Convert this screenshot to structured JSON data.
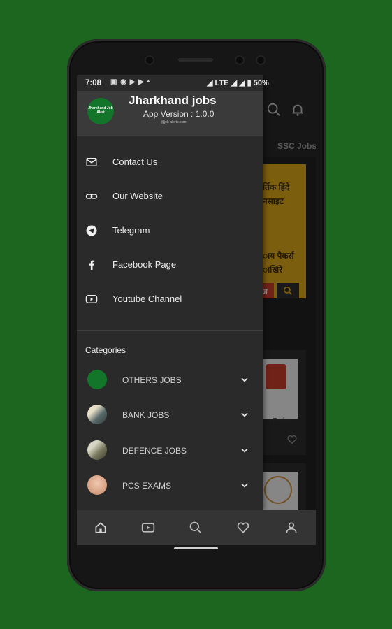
{
  "status_bar": {
    "time": "7:08",
    "network": "LTE",
    "battery": "50%"
  },
  "drawer": {
    "logo_text": "Jharkhand Job Alert",
    "title": "Jharkhand jobs",
    "version": "App Version : 1.0.0",
    "website": "@job-alerts.com",
    "menu": [
      {
        "label": "Contact Us",
        "icon": "mail-icon"
      },
      {
        "label": "Our Website",
        "icon": "link-icon"
      },
      {
        "label": "Telegram",
        "icon": "telegram-icon"
      },
      {
        "label": "Facebook Page",
        "icon": "facebook-icon"
      },
      {
        "label": "Youtube Channel",
        "icon": "youtube-icon"
      }
    ],
    "categories_heading": "Categories",
    "categories": [
      {
        "label": "OTHERS JOBS",
        "thumb_color": "#13752a"
      },
      {
        "label": "BANK JOBS",
        "thumb_color": "#6e6a5c"
      },
      {
        "label": "DEFENCE JOBS",
        "thumb_color": "#8a8a78"
      },
      {
        "label": "PCS EXAMS",
        "thumb_color": "#d9a58a"
      }
    ]
  },
  "background": {
    "tab": "SSC Jobs",
    "banner_lines": [
      "र्तिक हिंदे",
      "नसाइट",
      "ाय पैकर्स",
      "ाखिरे",
      "ज"
    ],
    "card_caption": "a Police"
  },
  "bottom_nav": [
    "home-icon",
    "video-icon",
    "search-icon",
    "heart-icon",
    "profile-icon"
  ],
  "colors": {
    "background_green": "#1c6620",
    "drawer": "#2a2a2a",
    "banner_yellow": "#d6a21b"
  }
}
